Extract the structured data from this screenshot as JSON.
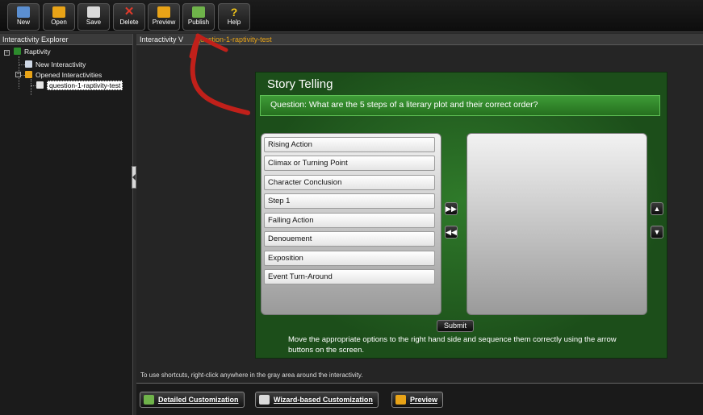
{
  "toolbar": {
    "buttons": [
      {
        "label": "New",
        "icon": "new-document-icon",
        "color": "#5b8fd1"
      },
      {
        "label": "Open",
        "icon": "open-folder-icon",
        "color": "#e8a317"
      },
      {
        "label": "Save",
        "icon": "save-disk-icon",
        "color": "#d9d9d9"
      },
      {
        "label": "Delete",
        "icon": "delete-x-icon",
        "color": "#e03a2b"
      },
      {
        "label": "Preview",
        "icon": "preview-magnifier-icon",
        "color": "#e8a317"
      },
      {
        "label": "Publish",
        "icon": "publish-folder-icon",
        "color": "#6fb34a"
      },
      {
        "label": "Help",
        "icon": "help-question-icon",
        "color": "#f0c419"
      }
    ]
  },
  "explorer": {
    "title": "Interactivity Explorer",
    "root": "Raptivity",
    "new_item": "New Interactivity",
    "opened_group": "Opened Interactivities",
    "opened_item": "question-1-raptivity-test"
  },
  "viewer": {
    "title_prefix": "Interactivity V",
    "title_file": "question-1-raptivity-test",
    "hint": "To use shortcuts, right-click anywhere in the gray area around the interactivity."
  },
  "interactivity": {
    "title": "Story Telling",
    "question": "Question: What are the 5 steps of a literary plot and their correct order?",
    "options": [
      "Rising Action",
      "Climax or Turning Point",
      "Character Conclusion",
      "Step 1",
      "Falling Action",
      "Denouement",
      "Exposition",
      "Event Turn-Around"
    ],
    "submit_label": "Submit",
    "instructions": "Move the appropriate options to the right hand side and sequence them correctly using the arrow buttons on the screen."
  },
  "bottom": {
    "detailed": "Detailed Customization",
    "wizard": "Wizard-based Customization",
    "preview": "Preview"
  },
  "colors": {
    "accent_orange": "#e8a317",
    "annotation_red": "#c0201a",
    "stage_green": "#2f7a2a"
  }
}
